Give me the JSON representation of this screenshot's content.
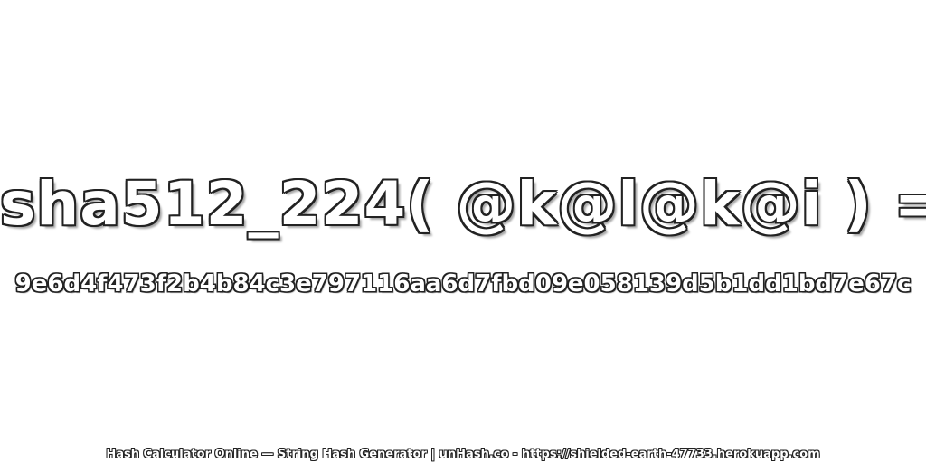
{
  "expression": "sha512_224( @k@l@k@i ) =",
  "hash_value": "9e6d4f473f2b4b84c3e797116aa6d7fbd09e058139d5b1dd1bd7e67c",
  "footer": "Hash Calculator Online — String Hash Generator | unHash.co - https://shielded-earth-47733.herokuapp.com",
  "colors": {
    "background": "#ffffff",
    "text_fill": "#ffffff",
    "text_outline": "#222222"
  }
}
